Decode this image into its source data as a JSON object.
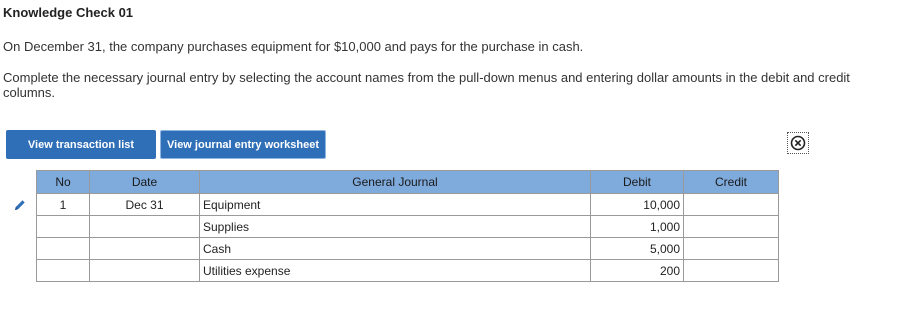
{
  "header": {
    "title": "Knowledge Check 01"
  },
  "question": {
    "line1": "On December 31, the company purchases equipment for $10,000 and pays for the purchase in cash.",
    "line2": "Complete the necessary journal entry by selecting the account names from the pull-down menus and entering dollar amounts in the debit and credit columns."
  },
  "buttons": {
    "transaction_list": "View transaction list",
    "journal_worksheet": "View journal entry worksheet"
  },
  "icons": {
    "close": "close-circle-icon",
    "edit": "pencil-icon"
  },
  "colors": {
    "button_bg": "#2f6fb8",
    "table_header_bg": "#7faadc",
    "pencil": "#2f6fb8"
  },
  "table": {
    "headers": {
      "no": "No",
      "date": "Date",
      "journal": "General Journal",
      "debit": "Debit",
      "credit": "Credit"
    },
    "rows": [
      {
        "no": "1",
        "date": "Dec 31",
        "account": "Equipment",
        "debit": "10,000",
        "credit": ""
      },
      {
        "no": "",
        "date": "",
        "account": "Supplies",
        "debit": "1,000",
        "credit": ""
      },
      {
        "no": "",
        "date": "",
        "account": "Cash",
        "debit": "5,000",
        "credit": ""
      },
      {
        "no": "",
        "date": "",
        "account": "Utilities expense",
        "debit": "200",
        "credit": ""
      }
    ]
  }
}
